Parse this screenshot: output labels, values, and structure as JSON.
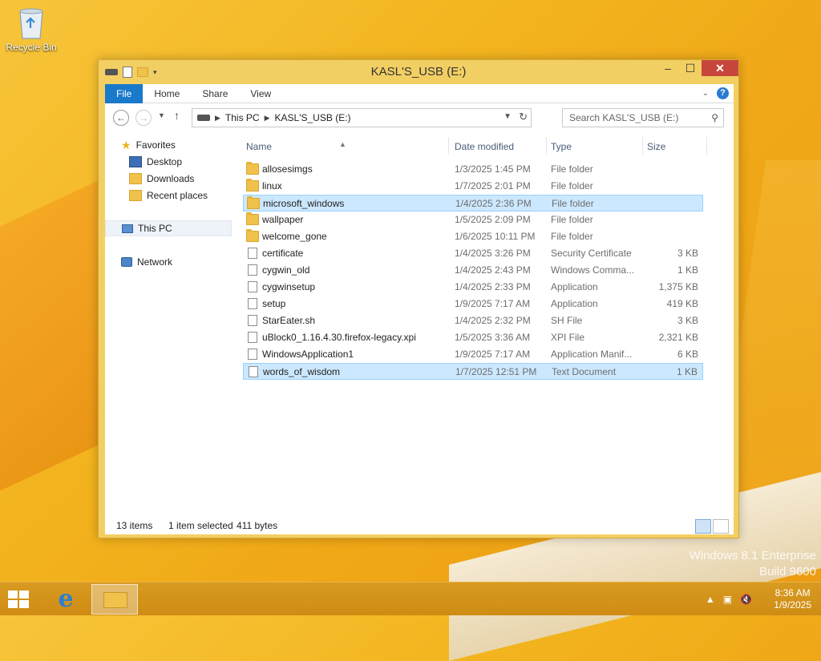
{
  "desktop": {
    "recycle_bin_label": "Recycle Bin",
    "branding_line1": "Windows 8.1 Enterprise",
    "branding_line2": "Build 9600"
  },
  "window": {
    "title": "KASL'S_USB (E:)",
    "controls": {
      "minimize": "–",
      "maximize": "☐",
      "close": "✕"
    },
    "ribbon_tabs": [
      {
        "label": "File"
      },
      {
        "label": "Home"
      },
      {
        "label": "Share"
      },
      {
        "label": "View"
      }
    ],
    "address": {
      "crumbs": [
        "This PC",
        "KASL'S_USB (E:)"
      ]
    },
    "search": {
      "placeholder": "Search KASL'S_USB (E:)"
    },
    "navigation": {
      "favorites": "Favorites",
      "favorites_items": [
        "Desktop",
        "Downloads",
        "Recent places"
      ],
      "this_pc": "This PC",
      "network": "Network"
    },
    "columns": {
      "name": "Name",
      "date": "Date modified",
      "type": "Type",
      "size": "Size"
    },
    "files": [
      {
        "name": "allosesimgs",
        "date": "1/3/2025 1:45 PM",
        "type": "File folder",
        "size": "",
        "icon": "folder-icon"
      },
      {
        "name": "linux",
        "date": "1/7/2025 2:01 PM",
        "type": "File folder",
        "size": "",
        "icon": "folder-icon"
      },
      {
        "name": "microsoft_windows",
        "date": "1/4/2025 2:36 PM",
        "type": "File folder",
        "size": "",
        "icon": "folder-icon"
      },
      {
        "name": "wallpaper",
        "date": "1/5/2025 2:09 PM",
        "type": "File folder",
        "size": "",
        "icon": "folder-icon"
      },
      {
        "name": "welcome_gone",
        "date": "1/6/2025 10:11 PM",
        "type": "File folder",
        "size": "",
        "icon": "folder-icon"
      },
      {
        "name": "certificate",
        "date": "1/4/2025 3:26 PM",
        "type": "Security Certificate",
        "size": "3 KB",
        "icon": "certificate-icon"
      },
      {
        "name": "cygwin_old",
        "date": "1/4/2025 2:43 PM",
        "type": "Windows Comma...",
        "size": "1 KB",
        "icon": "command-script-icon"
      },
      {
        "name": "cygwinsetup",
        "date": "1/4/2025 2:33 PM",
        "type": "Application",
        "size": "1,375 KB",
        "icon": "cygwin-app-icon"
      },
      {
        "name": "setup",
        "date": "1/9/2025 7:17 AM",
        "type": "Application",
        "size": "419 KB",
        "icon": "setup-app-icon"
      },
      {
        "name": "StarEater.sh",
        "date": "1/4/2025 2:32 PM",
        "type": "SH File",
        "size": "3 KB",
        "icon": "file-icon"
      },
      {
        "name": "uBlock0_1.16.4.30.firefox-legacy.xpi",
        "date": "1/5/2025 3:36 AM",
        "type": "XPI File",
        "size": "2,321 KB",
        "icon": "file-icon"
      },
      {
        "name": "WindowsApplication1",
        "date": "1/9/2025 7:17 AM",
        "type": "Application Manif...",
        "size": "6 KB",
        "icon": "manifest-icon"
      },
      {
        "name": "words_of_wisdom",
        "date": "1/7/2025 12:51 PM",
        "type": "Text Document",
        "size": "1 KB",
        "icon": "text-file-icon"
      }
    ],
    "status": {
      "item_count": "13 items",
      "selection": "1 item selected",
      "selection_size": "411 bytes"
    }
  },
  "taskbar": {
    "time": "8:36 AM",
    "date": "1/9/2025"
  },
  "colors": {
    "accent_file_tab": "#1979ca",
    "selection_fill": "#cce8ff",
    "window_border": "#f2cf63",
    "close_button": "#c7463c"
  }
}
